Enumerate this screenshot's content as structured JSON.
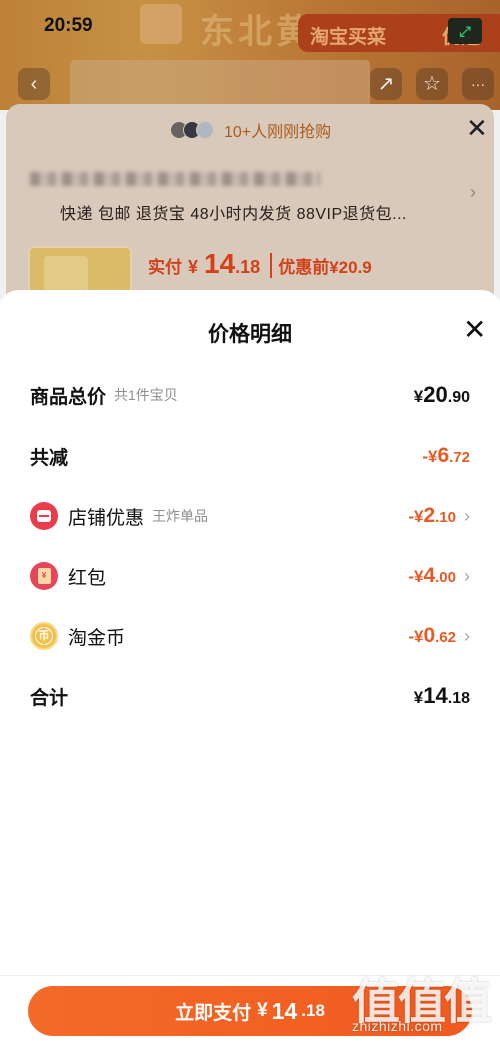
{
  "status_bar": {
    "time": "20:59"
  },
  "background": {
    "promo_left": "淘宝买菜",
    "promo_right": "优选",
    "banner_text": "东北黄",
    "buyers_text": "10+人刚刚抢购",
    "shipping_info": "快递 包邮 退货宝 48小时内发货 88VIP退货包...",
    "price_label": "实付",
    "price_currency": "¥",
    "price_int": "14",
    "price_dec": ".18",
    "price_before": "优惠前¥20.9"
  },
  "sheet": {
    "title": "价格明细",
    "rows": {
      "total": {
        "label": "商品总价",
        "sub": "共1件宝贝",
        "cur": "¥",
        "int": "20",
        "dec": ".90"
      },
      "reduce": {
        "label": "共减",
        "cur": "-¥",
        "int": "6",
        "dec": ".72"
      },
      "store": {
        "label": "店铺优惠",
        "sub": "王炸单品",
        "cur": "-¥",
        "int": "2",
        "dec": ".10"
      },
      "redpacket": {
        "label": "红包",
        "cur": "-¥",
        "int": "4",
        "dec": ".00"
      },
      "coin": {
        "label": "淘金币",
        "cur": "-¥",
        "int": "0",
        "dec": ".62"
      },
      "sum": {
        "label": "合计",
        "cur": "¥",
        "int": "14",
        "dec": ".18"
      }
    },
    "pay_button": {
      "label": "立即支付",
      "cur": "¥",
      "int": "14",
      "dec": ".18"
    }
  },
  "watermark": {
    "glyphs": "值值值",
    "url": "zhizhizhi.com"
  },
  "colors": {
    "accent": "#f05a1f",
    "discount": "#e85a23"
  }
}
